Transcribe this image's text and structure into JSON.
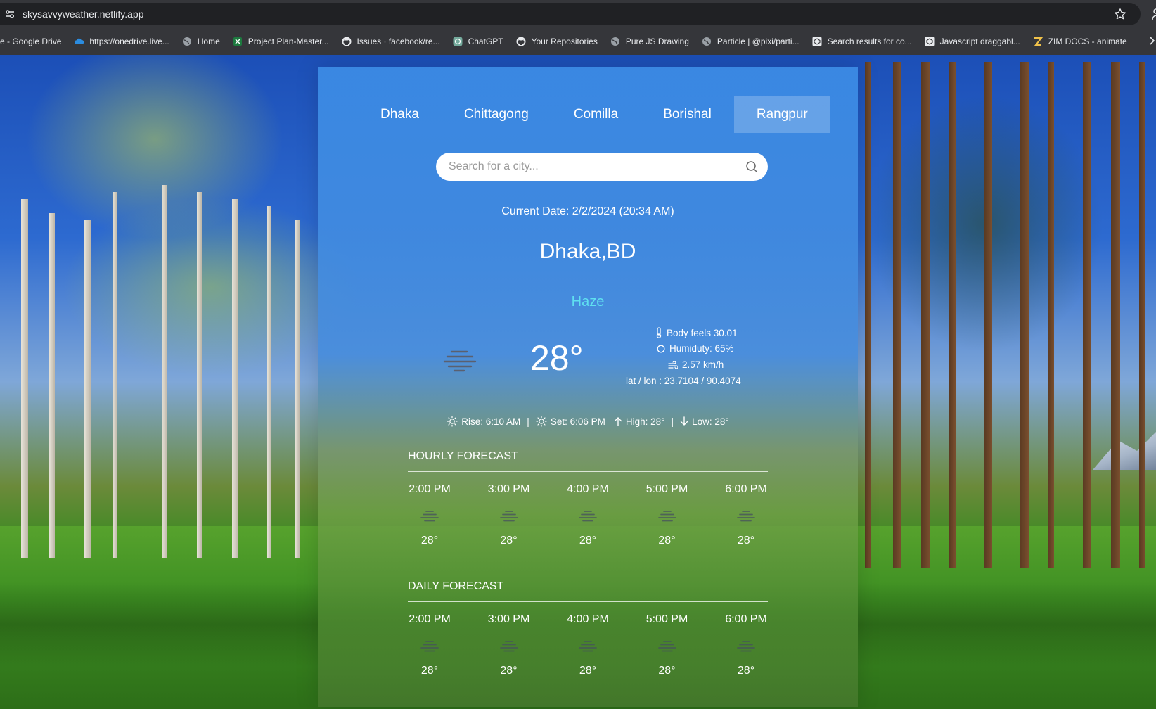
{
  "browser": {
    "url": "skysavvyweather.netlify.app",
    "bookmarks": [
      {
        "label": "e - Google Drive",
        "icon": "google-drive-icon"
      },
      {
        "label": "https://onedrive.live...",
        "icon": "onedrive-icon"
      },
      {
        "label": "Home",
        "icon": "globe-icon"
      },
      {
        "label": "Project Plan-Master...",
        "icon": "excel-icon"
      },
      {
        "label": "Issues · facebook/re...",
        "icon": "github-icon"
      },
      {
        "label": "ChatGPT",
        "icon": "chatgpt-icon"
      },
      {
        "label": "Your Repositories",
        "icon": "github-icon"
      },
      {
        "label": "Pure JS Drawing",
        "icon": "globe-icon"
      },
      {
        "label": "Particle | @pixi/parti...",
        "icon": "globe-icon"
      },
      {
        "label": "Search results for co...",
        "icon": "codepen-icon"
      },
      {
        "label": "Javascript draggabl...",
        "icon": "codepen-icon"
      },
      {
        "label": "ZIM DOCS - animate",
        "icon": "zim-icon"
      }
    ]
  },
  "weather": {
    "tabs": [
      {
        "label": "Dhaka",
        "active": false
      },
      {
        "label": "Chittagong",
        "active": false
      },
      {
        "label": "Comilla",
        "active": false
      },
      {
        "label": "Borishal",
        "active": false
      },
      {
        "label": "Rangpur",
        "active": true
      }
    ],
    "search": {
      "placeholder": "Search for a city..."
    },
    "current_date": "Current Date: 2/2/2024 (20:34 AM)",
    "location": "Dhaka,BD",
    "condition": "Haze",
    "condition_color": "#5fe0f0",
    "temperature": "28°",
    "condition_icon": "haze-icon",
    "details": {
      "feels": "Body feels 30.01",
      "humidity": "Humiduty: 65%",
      "wind": "2.57 km/h",
      "latlon": "lat / lon : 23.7104 / 90.4074"
    },
    "sun": {
      "rise": "Rise: 6:10 AM",
      "set": "Set: 6:06 PM",
      "high": "High: 28°",
      "low": "Low: 28°",
      "separator": "|"
    },
    "hourly": {
      "title": "HOURLY FORECAST",
      "items": [
        {
          "time": "2:00 PM",
          "temp": "28°"
        },
        {
          "time": "3:00 PM",
          "temp": "28°"
        },
        {
          "time": "4:00 PM",
          "temp": "28°"
        },
        {
          "time": "5:00 PM",
          "temp": "28°"
        },
        {
          "time": "6:00 PM",
          "temp": "28°"
        }
      ]
    },
    "daily": {
      "title": "DAILY FORECAST",
      "items": [
        {
          "time": "2:00 PM",
          "temp": "28°"
        },
        {
          "time": "3:00 PM",
          "temp": "28°"
        },
        {
          "time": "4:00 PM",
          "temp": "28°"
        },
        {
          "time": "5:00 PM",
          "temp": "28°"
        },
        {
          "time": "6:00 PM",
          "temp": "28°"
        }
      ]
    }
  }
}
